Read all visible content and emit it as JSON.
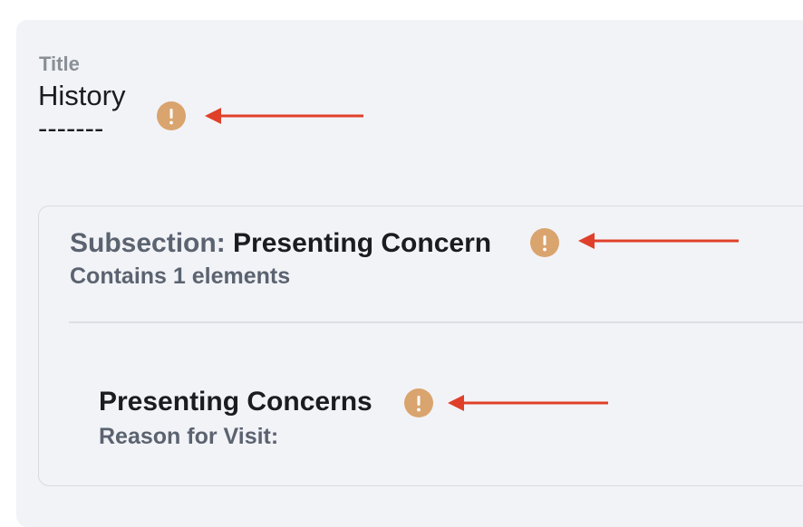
{
  "section": {
    "title_label": "Title",
    "title_value": "History\n-------"
  },
  "subsection": {
    "prefix": "Subsection: ",
    "name": "Presenting Concern",
    "count_text": "Contains 1 elements"
  },
  "element": {
    "name": "Presenting Concerns",
    "description": "Reason for Visit:"
  },
  "icons": {
    "warning": "exclamation-circle-icon",
    "arrow": "left-arrow-icon"
  },
  "colors": {
    "warning_fill": "#d9a46e",
    "arrow": "#e0402a"
  }
}
